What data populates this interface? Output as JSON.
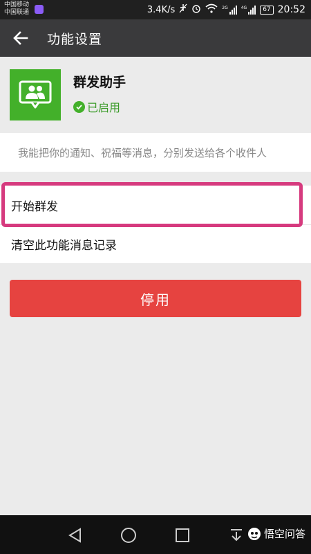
{
  "status_bar": {
    "carrier_1": "中国移动",
    "carrier_2": "中国联通",
    "speed": "3.4K/s",
    "network_1": "2G",
    "network_2": "4G",
    "battery": "67",
    "time": "20:52"
  },
  "header": {
    "title": "功能设置"
  },
  "app": {
    "name": "群发助手",
    "status": "已启用",
    "description": "我能把你的通知、祝福等消息，分别发送给各个收件人"
  },
  "actions": {
    "items": [
      {
        "label": "开始群发"
      },
      {
        "label": "清空此功能消息记录"
      }
    ],
    "stop_label": "停用"
  },
  "watermark": {
    "text": "悟空问答"
  },
  "colors": {
    "app_icon_bg": "#43b02a",
    "highlight": "#d63a7e",
    "stop_button": "#e64340",
    "title_bar": "#3a3a3c"
  },
  "icons": {
    "back": "arrow-left-icon",
    "app": "people-chat-icon",
    "status": "check-circle-icon",
    "nav": [
      "triangle-back-icon",
      "circle-home-icon",
      "square-recent-icon",
      "download-arrow-icon"
    ]
  }
}
